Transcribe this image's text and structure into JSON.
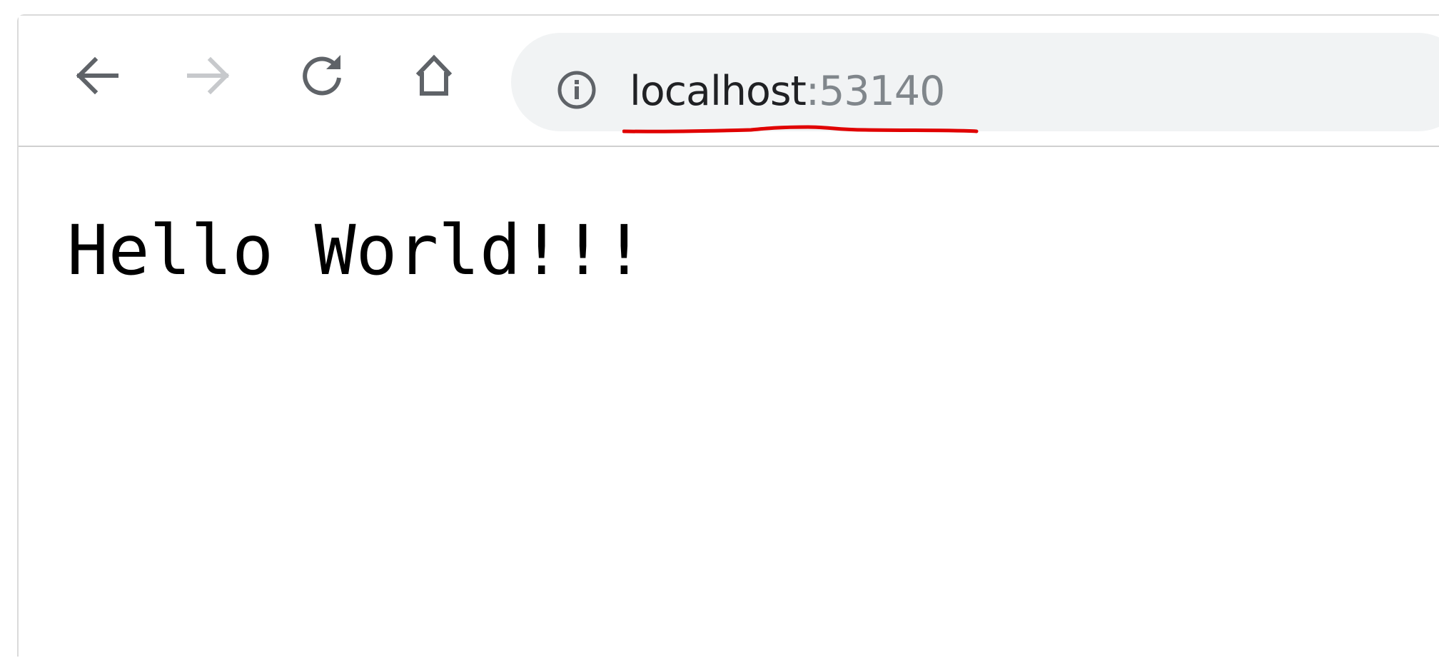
{
  "toolbar": {
    "back_icon": "arrow-left-icon",
    "forward_icon": "arrow-right-icon",
    "reload_icon": "reload-icon",
    "home_icon": "home-icon"
  },
  "address_bar": {
    "info_icon": "info-icon",
    "host": "localhost",
    "port": ":53140",
    "annotation_color": "#e00000"
  },
  "page": {
    "body_text": "Hello World!!!"
  },
  "colors": {
    "icon_active": "#5f6368",
    "icon_disabled": "#c7c9cc",
    "omnibox_bg": "#f1f3f4",
    "url_host": "#202124",
    "url_port": "#80868b"
  }
}
